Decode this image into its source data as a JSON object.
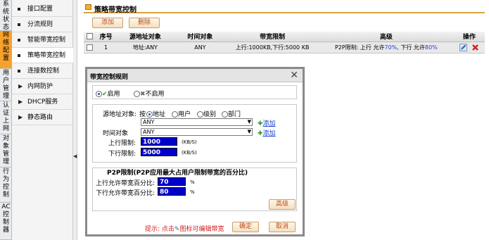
{
  "nav": {
    "tabs": [
      {
        "label": "系统状态"
      },
      {
        "label": "网络配置"
      },
      {
        "label": "用户管理"
      },
      {
        "label": "认证上网"
      },
      {
        "label": "对象管理"
      },
      {
        "label": "行为控制"
      },
      {
        "label": "AC控制器"
      }
    ],
    "submenu": [
      {
        "label": "接口配置"
      },
      {
        "label": "分流规则"
      },
      {
        "label": "智能带宽控制"
      },
      {
        "label": "策略带宽控制"
      },
      {
        "label": "连接数控制"
      },
      {
        "label": "内网防护"
      },
      {
        "label": "DHCP服务"
      },
      {
        "label": "静态路由"
      }
    ],
    "collapse_arrow": "◀"
  },
  "page": {
    "title": "策略带宽控制",
    "add_label": "添加",
    "delete_label": "删除"
  },
  "table": {
    "headers": [
      "序号",
      "源地址对象",
      "时间对象",
      "带宽限制",
      "高级",
      "操作"
    ],
    "rows": [
      {
        "index": "1",
        "source": "地址:ANY",
        "time": "ANY",
        "bandwidth": "上行:1000KB,下行:5000 KB",
        "advanced_prefix": "P2P限制: 上行 允许",
        "up_pct": "70%",
        "advanced_mid": ", 下行 允许",
        "down_pct": "80%"
      }
    ]
  },
  "dialog": {
    "title": "带宽控制规则",
    "close": "✕",
    "enable_label": "启用",
    "disable_label": "不启用",
    "source_label": "源地址对象:",
    "source_by": "按",
    "source_options": [
      "地址",
      "用户",
      "级别",
      "部门"
    ],
    "source_value": "ANY",
    "add_link": "添加",
    "time_label": "时间对象",
    "time_value": "ANY",
    "up_label": "上行限制:",
    "up_value": "1000",
    "down_label": "下行限制:",
    "down_value": "5000",
    "unit": "(KB/S)",
    "p2p_title": "P2P限制(P2P应用最大占用户限制带宽的百分比)",
    "p2p_up_label": "上行允许带宽百分比:",
    "p2p_up_value": "70",
    "p2p_down_label": "下行允许带宽百分比:",
    "p2p_down_value": "80",
    "percent": "%",
    "advanced_button": "高级",
    "hint_prefix": "提示: 点击",
    "hint_suffix": "图标可编辑带宽",
    "ok_button": "确定",
    "cancel_button": "取消"
  }
}
